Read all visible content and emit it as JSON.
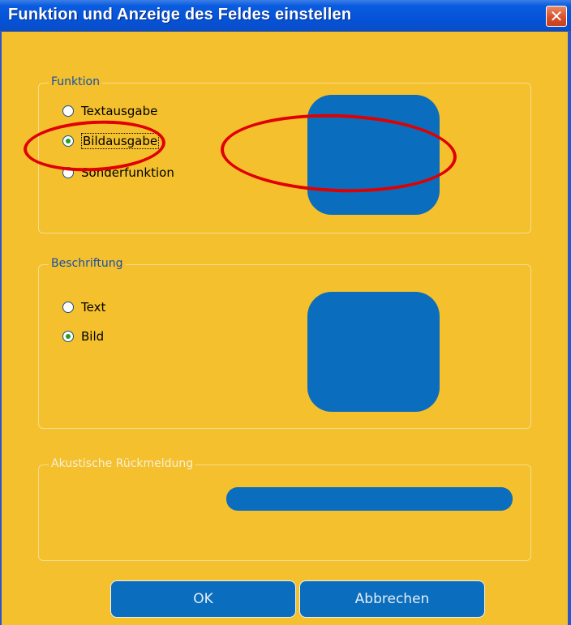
{
  "window": {
    "title": "Funktion und Anzeige des Feldes einstellen",
    "close_glyph": "✕"
  },
  "groups": {
    "function": {
      "label": "Funktion",
      "options": [
        {
          "label": "Textausgabe",
          "selected": false
        },
        {
          "label": "Bildausgabe",
          "selected": true
        },
        {
          "label": "Sonderfunktion",
          "selected": false
        }
      ]
    },
    "caption": {
      "label": "Beschriftung",
      "options": [
        {
          "label": "Text",
          "selected": false
        },
        {
          "label": "Bild",
          "selected": true
        }
      ]
    },
    "acoustic": {
      "label": "Akustische Rückmeldung"
    }
  },
  "buttons": {
    "ok": "OK",
    "cancel": "Abbrechen"
  },
  "colors": {
    "background": "#f4c02d",
    "accent": "#0a6dbd",
    "annotation": "#e00000"
  }
}
